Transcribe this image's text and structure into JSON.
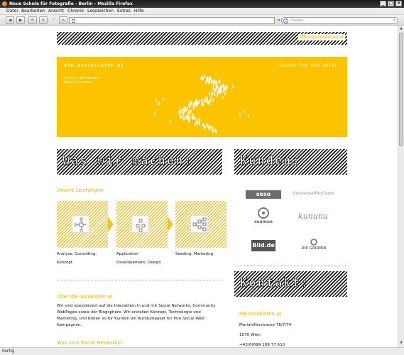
{
  "window": {
    "title": "Neue Schule für Fotografie - Berlin - Mozilla Firefox"
  },
  "menu": [
    "Datei",
    "Bearbeiten",
    "Ansicht",
    "Chronik",
    "Lesezeichen",
    "Extras",
    "Hilfe"
  ],
  "nav": {
    "search_placeholder": "Google"
  },
  "status": "Fertig",
  "page": {
    "email": "office@socialisten.at",
    "banner_title": "die.socialisten.at",
    "banner_sub": "SOCIAL NETWORK DEVELOPMENT",
    "banner_thanks": "thanks for the ad(d).",
    "section_was": "Was wir machen:",
    "section_kunden": "Kunden:",
    "section_kontakt": "Kontakt:",
    "leistungen_label": "Unsere Leistungen",
    "services": [
      {
        "label_1": "Analyse, Consulting,",
        "label_2": "Konzept"
      },
      {
        "label_1": "Application",
        "label_2": "Developement, Design"
      },
      {
        "label_1": "Seeding, Marketing",
        "label_2": ""
      }
    ],
    "about_title": "Über die socialisten.at",
    "about_text": "Wir sind spezialisiert auf die Interaktion in und mit Social Networks, Community WebPages sowie der Blogsphere. Wir erstellen Konzept, Technologie und Marketing, und bieten so für Kunden ein Rundumpaket für Ihre Social Web Kampagnen.",
    "question": "Was sind Social Networks?",
    "clients": [
      "seso",
      "UniversalMcCann",
      "seamee",
      "kununu",
      "Bild.de",
      "DIE GRÜNEN"
    ],
    "contact": {
      "name": "die.socialisten.at",
      "street": "Mariahilferstrasse 76/7/74",
      "city": "1070 Wien",
      "phone": "+43(0)699 109 77 610"
    }
  }
}
